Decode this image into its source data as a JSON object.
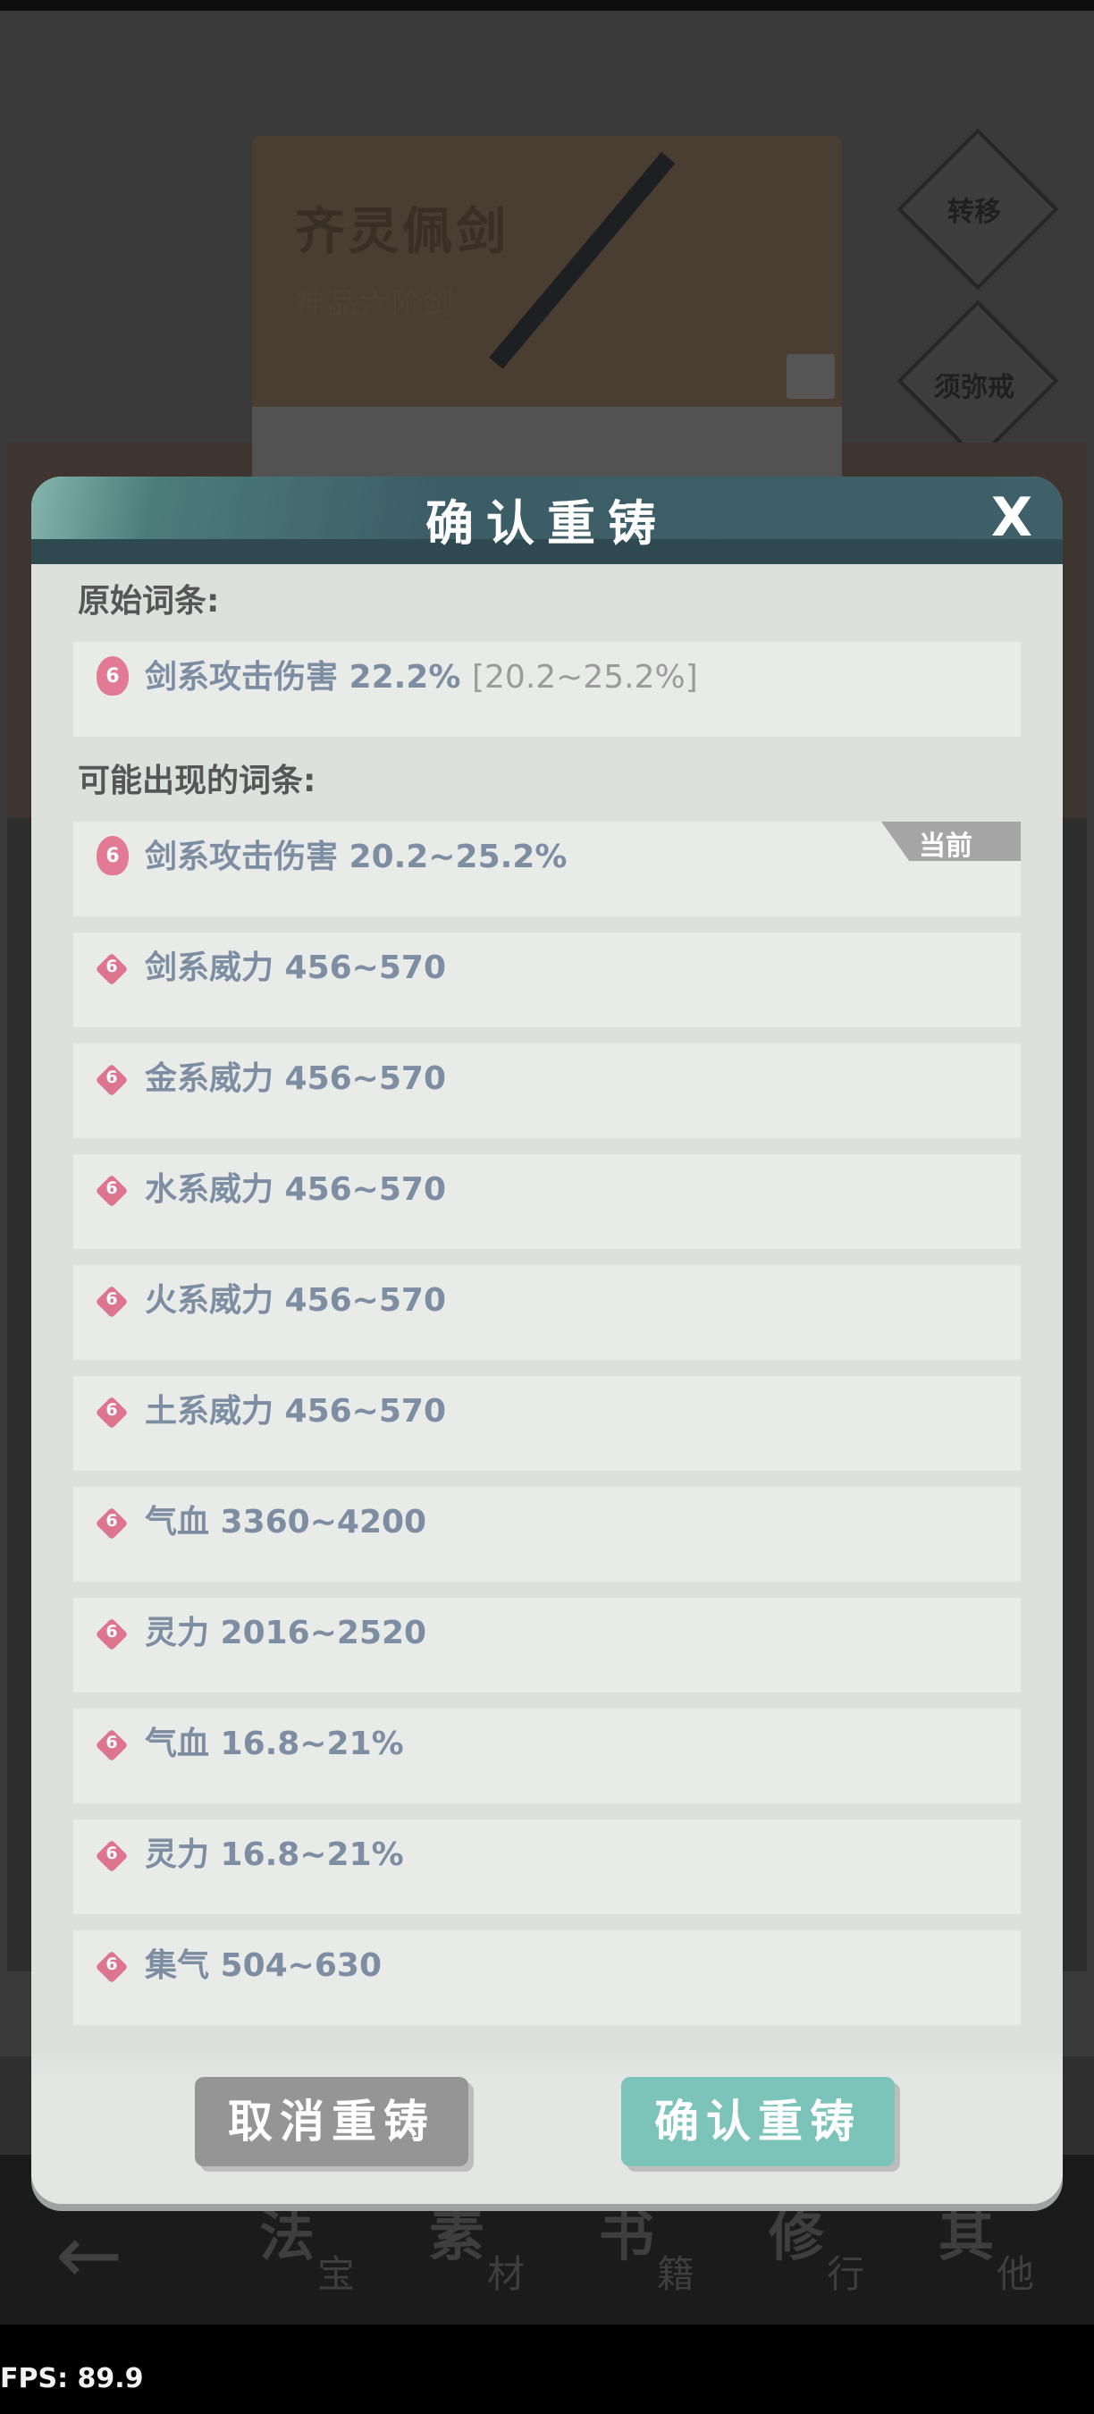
{
  "background": {
    "item_name": "齐灵佩剑",
    "item_grade": "神品六阶剑",
    "side_buttons": [
      "转移",
      "须弥戒"
    ],
    "nav_tabs": [
      {
        "main": "法",
        "sub": "宝"
      },
      {
        "main": "素",
        "sub": "材"
      },
      {
        "main": "书",
        "sub": "籍"
      },
      {
        "main": "修",
        "sub": "行"
      },
      {
        "main": "其",
        "sub": "他"
      }
    ],
    "back_arrow": "←"
  },
  "dialog": {
    "title": "确认重铸",
    "close_label": "X",
    "original_label": "原始词条:",
    "original_entry": {
      "icon": "6",
      "text": "剑系攻击伤害 22.2%",
      "range": "[20.2~25.2%]"
    },
    "possible_label": "可能出现的词条:",
    "current_tag": "当前",
    "entries": [
      {
        "icon": "6",
        "text": "剑系攻击伤害 20.2~25.2%"
      },
      {
        "icon": "6",
        "text": "剑系威力 456~570"
      },
      {
        "icon": "6",
        "text": "金系威力 456~570"
      },
      {
        "icon": "6",
        "text": "水系威力 456~570"
      },
      {
        "icon": "6",
        "text": "火系威力 456~570"
      },
      {
        "icon": "6",
        "text": "土系威力 456~570"
      },
      {
        "icon": "6",
        "text": "气血 3360~4200"
      },
      {
        "icon": "6",
        "text": "灵力 2016~2520"
      },
      {
        "icon": "6",
        "text": "气血 16.8~21%"
      },
      {
        "icon": "6",
        "text": "灵力 16.8~21%"
      },
      {
        "icon": "6",
        "text": "集气 504~630"
      }
    ],
    "cancel_label": "取消重铸",
    "confirm_label": "确认重铸"
  },
  "fps": "FPS: 89.9"
}
